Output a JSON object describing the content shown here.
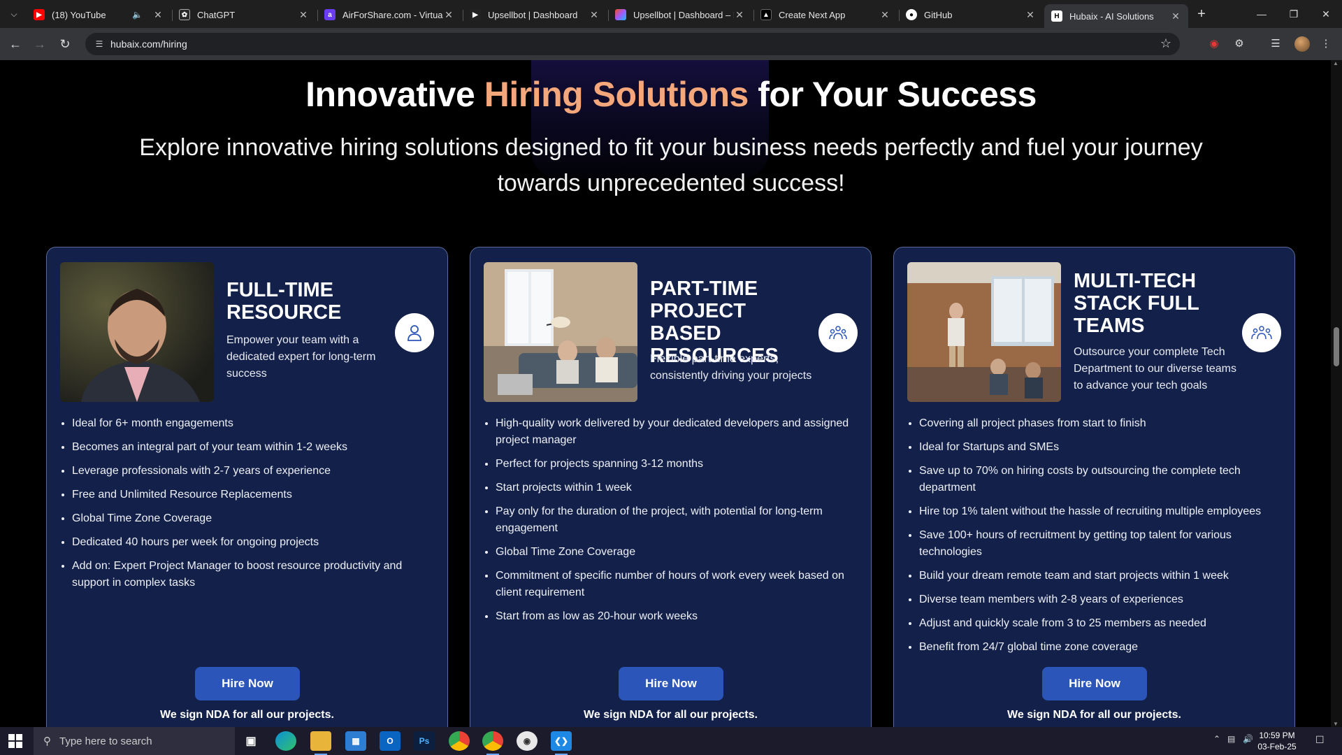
{
  "browser": {
    "tabs": [
      {
        "title": "(18) YouTube",
        "favicon": "youtube-icon",
        "favicon_color": "#ff0000",
        "audio": true
      },
      {
        "title": "ChatGPT",
        "favicon": "chatgpt-icon",
        "favicon_color": "#2a2a2a"
      },
      {
        "title": "AirForShare.com - Virtual",
        "favicon": "airforshare-icon",
        "favicon_color": "#6a3df2"
      },
      {
        "title": "Upsellbot | Dashboard",
        "favicon": "upsellbot-icon",
        "favicon_color": "#222222"
      },
      {
        "title": "Upsellbot | Dashboard – F",
        "favicon": "figma-icon",
        "favicon_color": "#f24e1e"
      },
      {
        "title": "Create Next App",
        "favicon": "vercel-icon",
        "favicon_color": "#000000"
      },
      {
        "title": "GitHub",
        "favicon": "github-icon",
        "favicon_color": "#ffffff"
      },
      {
        "title": "Hubaix - AI Solutions",
        "favicon": "hubaix-icon",
        "favicon_color": "#ffffff",
        "active": true
      }
    ],
    "url": "hubaix.com/hiring"
  },
  "hero": {
    "title_before": "Innovative ",
    "title_accent": "Hiring Solutions",
    "title_after": " for Your Success",
    "subtitle": "Explore innovative hiring solutions designed to fit your business needs perfectly and fuel your journey towards unprecedented success!",
    "accent_color": "#f4a77a"
  },
  "cards": [
    {
      "title": "FULL-TIME RESOURCE",
      "description": "Empower your team with a dedicated expert for long-term success",
      "badge_icon": "person-icon",
      "photo": "professional-man-portrait",
      "bullets": [
        "Ideal for 6+ month engagements",
        "Becomes an integral part of your team within 1-2 weeks",
        "Leverage professionals with 2-7 years of experience",
        "Free and Unlimited Resource Replacements",
        "Global Time Zone Coverage",
        "Dedicated 40 hours per week for ongoing projects",
        "Add on: Expert Project Manager to boost resource productivity and support in complex tasks"
      ],
      "button": "Hire Now",
      "note": "We sign NDA for all our projects."
    },
    {
      "title": "PART-TIME PROJECT BASED RESOURCES",
      "description": "Flexible part-time experts, consistently driving your projects",
      "badge_icon": "team-icon",
      "photo": "people-working-on-laptops",
      "bullets": [
        "High-quality work delivered by your dedicated developers and assigned project manager",
        "Perfect for projects spanning 3-12 months",
        "Start projects within 1 week",
        "Pay only for the duration of the project, with potential for long-term engagement",
        "Global Time Zone Coverage",
        "Commitment of specific number of hours of work every week based on client requirement",
        "Start from as low as 20-hour work weeks"
      ],
      "button": "Hire Now",
      "note": "We sign NDA for all our projects."
    },
    {
      "title": "MULTI-TECH STACK FULL TEAMS",
      "description": "Outsource your complete Tech Department to our diverse teams to advance your tech goals",
      "badge_icon": "team-icon",
      "photo": "team-meeting-office",
      "bullets": [
        "Covering all project phases from start to finish",
        "Ideal for Startups and SMEs",
        "Save up to 70% on hiring costs by outsourcing the complete tech department",
        "Hire top 1% talent without the hassle of recruiting multiple employees",
        "Save 100+ hours of recruitment by getting top talent for various technologies",
        "Build your dream remote team and start projects within 1 week",
        "Diverse team members with 2-8 years of experiences",
        "Adjust and quickly scale from 3 to 25 members as needed",
        "Benefit from 24/7 global time zone coverage"
      ],
      "button": "Hire Now",
      "note": "We sign NDA for all our projects."
    }
  ],
  "taskbar": {
    "search_placeholder": "Type here to search",
    "time": "10:59 PM",
    "date": "03-Feb-25"
  },
  "colors": {
    "card_bg": "#13214a",
    "button_bg": "#2b55b8"
  }
}
